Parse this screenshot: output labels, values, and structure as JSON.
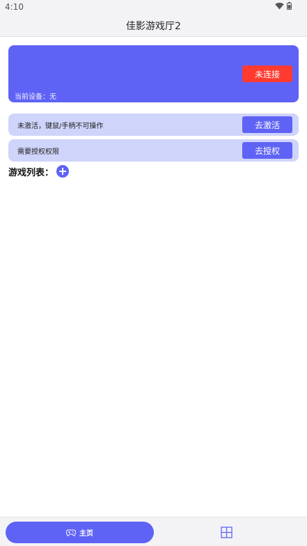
{
  "status_bar": {
    "time": "4:10",
    "icons": [
      "wifi-icon",
      "battery-icon"
    ]
  },
  "app_bar": {
    "title": "佳影游戏厅2"
  },
  "device_card": {
    "connect_label": "未连接",
    "current_device": "当前设备：无",
    "card_color": "#5f63f5",
    "connect_color": "#ff3b30"
  },
  "info_rows": [
    {
      "text": "未激活，键鼠/手柄不可操作",
      "button": "去激活"
    },
    {
      "text": "需要授权权限",
      "button": "去授权"
    }
  ],
  "game_list": {
    "title": "游戏列表：",
    "add_icon": "plus-circle-icon"
  },
  "bottom_nav": {
    "home_label": "主页",
    "home_icon": "gamepad-icon",
    "second_icon": "grid-icon",
    "accent": "#5f63f5"
  }
}
